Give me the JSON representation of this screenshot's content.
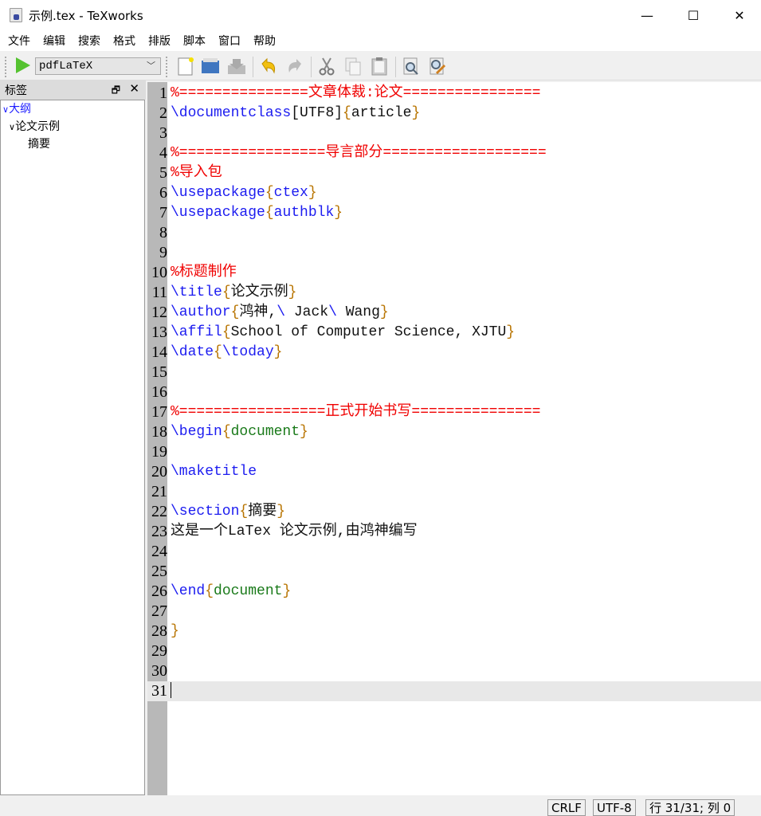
{
  "window": {
    "title": "示例.tex - TeXworks",
    "minimize": "—",
    "maximize": "☐",
    "close": "✕"
  },
  "menu": [
    "文件",
    "编辑",
    "搜索",
    "格式",
    "排版",
    "脚本",
    "窗口",
    "帮助"
  ],
  "toolbar": {
    "engine": "pdfLaTeX",
    "icons": [
      "new-document-icon",
      "open-folder-icon",
      "save-icon",
      "undo-icon",
      "redo-icon",
      "cut-icon",
      "copy-icon",
      "paste-icon",
      "find-icon",
      "replace-icon"
    ]
  },
  "panel": {
    "title": "标签",
    "float": "🗗",
    "close": "✕",
    "tree": [
      {
        "label": "大纲",
        "level": 0,
        "expanded": true
      },
      {
        "label": "论文示例",
        "level": 1,
        "expanded": true
      },
      {
        "label": "摘要",
        "level": 2
      }
    ]
  },
  "colors": {
    "command": "#1c1cf0",
    "brace": "#b87400",
    "comment": "#f00000",
    "environment": "#1a7a1a"
  },
  "editor": {
    "current_line": 31,
    "lines": [
      [
        [
          "cm",
          "%===============文章体裁:论文================"
        ]
      ],
      [
        [
          "cmd",
          "\\documentclass"
        ],
        [
          "tx",
          "[UTF8]"
        ],
        [
          "br",
          "{"
        ],
        [
          "tx",
          "article"
        ],
        [
          "br",
          "}"
        ]
      ],
      [],
      [
        [
          "cm",
          "%=================导言部分==================="
        ]
      ],
      [
        [
          "cm",
          "%导入包"
        ]
      ],
      [
        [
          "cmd",
          "\\usepackage"
        ],
        [
          "br",
          "{"
        ],
        [
          "cmd",
          "ctex"
        ],
        [
          "br",
          "}"
        ]
      ],
      [
        [
          "cmd",
          "\\usepackage"
        ],
        [
          "br",
          "{"
        ],
        [
          "cmd",
          "authblk"
        ],
        [
          "br",
          "}"
        ]
      ],
      [],
      [],
      [
        [
          "cm",
          "%标题制作"
        ]
      ],
      [
        [
          "cmd",
          "\\title"
        ],
        [
          "br",
          "{"
        ],
        [
          "tx",
          "论文示例"
        ],
        [
          "br",
          "}"
        ]
      ],
      [
        [
          "cmd",
          "\\author"
        ],
        [
          "br",
          "{"
        ],
        [
          "tx",
          "鸿神,"
        ],
        [
          "cmd",
          "\\ "
        ],
        [
          "tx",
          "Jack"
        ],
        [
          "cmd",
          "\\ "
        ],
        [
          "tx",
          "Wang"
        ],
        [
          "br",
          "}"
        ]
      ],
      [
        [
          "cmd",
          "\\affil"
        ],
        [
          "br",
          "{"
        ],
        [
          "tx",
          "School of Computer Science, XJTU"
        ],
        [
          "br",
          "}"
        ]
      ],
      [
        [
          "cmd",
          "\\date"
        ],
        [
          "br",
          "{"
        ],
        [
          "cmd",
          "\\today"
        ],
        [
          "br",
          "}"
        ]
      ],
      [],
      [],
      [
        [
          "cm",
          "%=================正式开始书写==============="
        ]
      ],
      [
        [
          "cmd",
          "\\begin"
        ],
        [
          "br",
          "{"
        ],
        [
          "grn",
          "document"
        ],
        [
          "br",
          "}"
        ]
      ],
      [],
      [
        [
          "cmd",
          "\\maketitle"
        ]
      ],
      [],
      [
        [
          "cmd",
          "\\section"
        ],
        [
          "br",
          "{"
        ],
        [
          "tx",
          "摘要"
        ],
        [
          "br",
          "}"
        ]
      ],
      [
        [
          "tx",
          "这是一个LaTex 论文示例,由鸿神编写"
        ]
      ],
      [],
      [],
      [
        [
          "cmd",
          "\\end"
        ],
        [
          "br",
          "{"
        ],
        [
          "grn",
          "document"
        ],
        [
          "br",
          "}"
        ]
      ],
      [],
      [
        [
          "br",
          "}"
        ]
      ],
      [],
      [],
      []
    ]
  },
  "status": {
    "line_ending": "CRLF",
    "encoding": "UTF-8",
    "position": "行 31/31; 列 0"
  }
}
